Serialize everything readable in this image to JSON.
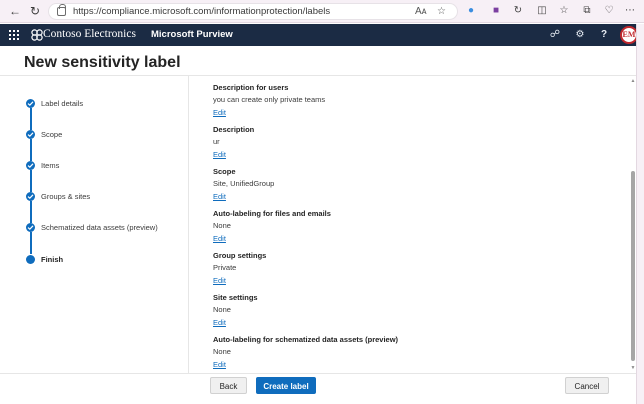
{
  "browser": {
    "url": "https://compliance.microsoft.com/informationprotection/labels",
    "reader_icon": "Aᴀ",
    "icons": [
      "back-icon",
      "refresh-icon",
      "lock-icon",
      "read-aloud-icon",
      "favorite-icon",
      "extension-icon",
      "collections-icon",
      "split-screen-icon",
      "favorites-bar-icon",
      "browser-essentials-icon",
      "more-icon"
    ]
  },
  "header": {
    "brand": "Contoso Electronics",
    "product": "Microsoft Purview",
    "avatar_initials": "EM",
    "colors": {
      "background": "#1b2b44",
      "avatar_border": "#c0282d"
    }
  },
  "page": {
    "title": "New sensitivity label"
  },
  "steps": [
    {
      "label": "Label details",
      "state": "completed"
    },
    {
      "label": "Scope",
      "state": "completed"
    },
    {
      "label": "Items",
      "state": "completed"
    },
    {
      "label": "Groups & sites",
      "state": "completed"
    },
    {
      "label": "Schematized data assets (preview)",
      "state": "completed"
    },
    {
      "label": "Finish",
      "state": "current"
    }
  ],
  "summary": [
    {
      "heading": "Description for users",
      "value": "you can create only private teams",
      "edit": "Edit"
    },
    {
      "heading": "Description",
      "value": "ur",
      "edit": "Edit"
    },
    {
      "heading": "Scope",
      "value": "Site, UnifiedGroup",
      "edit": "Edit"
    },
    {
      "heading": "Auto-labeling for files and emails",
      "value": "None",
      "edit": "Edit"
    },
    {
      "heading": "Group settings",
      "value": "Private",
      "edit": "Edit"
    },
    {
      "heading": "Site settings",
      "value": "None",
      "edit": "Edit"
    },
    {
      "heading": "Auto-labeling for schematized data assets (preview)",
      "value": "None",
      "edit": "Edit"
    }
  ],
  "footer": {
    "back": "Back",
    "create": "Create label",
    "cancel": "Cancel"
  },
  "colors": {
    "accent": "#0f6cbd",
    "text": "#242424"
  }
}
